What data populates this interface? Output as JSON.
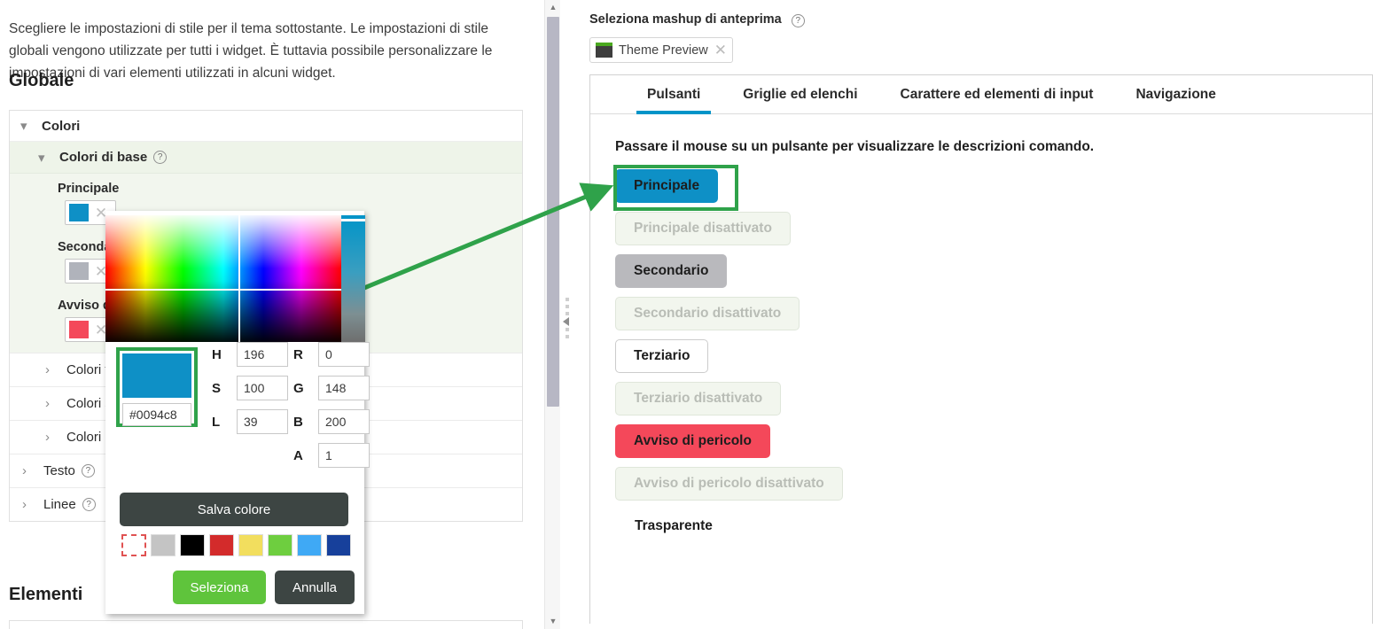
{
  "left": {
    "intro_text": "Scegliere le impostazioni di stile per il tema sottostante. Le impostazioni di stile globali vengono utilizzate per tutti i widget. È tuttavia possibile personalizzare le impostazioni di vari elementi utilizzati in alcuni widget.",
    "heading": "Globale",
    "bottom_heading": "Elementi",
    "sections": {
      "colori_label": "Colori",
      "colori_di_base_label": "Colori di base"
    },
    "color_items": [
      {
        "label": "Principale",
        "value": "#0094c8",
        "clear_icon": "close-icon"
      },
      {
        "label": "Secondario",
        "value": "#b9b9bd",
        "clear_icon": "close-icon"
      },
      {
        "label": "Avviso di pericolo",
        "value": "#f4485a",
        "clear_icon": "close-icon"
      }
    ],
    "sub_rows": [
      {
        "label": "Colori testo",
        "help": false
      },
      {
        "label": "Colori sfondo",
        "help": false
      },
      {
        "label": "Colori linee",
        "help": false
      }
    ],
    "top_rows": [
      {
        "label": "Testo",
        "help": true
      },
      {
        "label": "Linee",
        "help": true
      }
    ]
  },
  "picker": {
    "hex_value": "#0094c8",
    "preview_color": "#0e90c6",
    "fields": [
      {
        "label": "H",
        "value": "196"
      },
      {
        "label": "R",
        "value": "0"
      },
      {
        "label": "S",
        "value": "100"
      },
      {
        "label": "G",
        "value": "148"
      },
      {
        "label": "L",
        "value": "39"
      },
      {
        "label": "B",
        "value": "200"
      },
      {
        "label": "A",
        "value": "1"
      }
    ],
    "save_label": "Salva colore",
    "select_label": "Seleziona",
    "cancel_label": "Annulla",
    "presets": [
      "transparent",
      "#c4c4c4",
      "#000000",
      "#d32b2b",
      "#f2de5e",
      "#6ece3f",
      "#3fa9f5",
      "#17409b"
    ]
  },
  "right": {
    "preview_label": "Seleziona mashup di anteprima",
    "chip_label": "Theme Preview",
    "chip_close_icon": "close-icon",
    "tabs": [
      {
        "label": "Pulsanti",
        "active": true
      },
      {
        "label": "Griglie ed elenchi",
        "active": false
      },
      {
        "label": "Carattere ed elementi di input",
        "active": false
      },
      {
        "label": "Navigazione",
        "active": false
      }
    ],
    "hint": "Passare il mouse su un pulsante per visualizzare le descrizioni comando.",
    "buttons": [
      {
        "label": "Principale",
        "style": "pv-primary",
        "enabled": true
      },
      {
        "label": "Principale disattivato",
        "style": "pv-disabled",
        "enabled": false
      },
      {
        "label": "Secondario",
        "style": "pv-secondary",
        "enabled": true
      },
      {
        "label": "Secondario disattivato",
        "style": "pv-disabled",
        "enabled": false
      },
      {
        "label": "Terziario",
        "style": "pv-tertiary",
        "enabled": true
      },
      {
        "label": "Terziario disattivato",
        "style": "pv-disabled",
        "enabled": false
      },
      {
        "label": "Avviso di pericolo",
        "style": "pv-danger",
        "enabled": true
      },
      {
        "label": "Avviso di pericolo disattivato",
        "style": "pv-disabled",
        "enabled": false
      },
      {
        "label": "Trasparente",
        "style": "pv-transparent",
        "enabled": true
      }
    ]
  },
  "annotation": {
    "highlight_color": "#2fa24a",
    "arrow_color": "#2fa24a"
  }
}
